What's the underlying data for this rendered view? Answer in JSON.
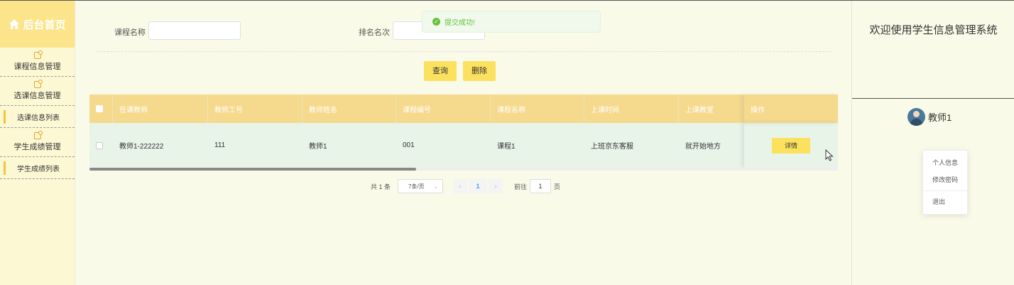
{
  "sidebar": {
    "brand_title": "后台首页",
    "groups": [
      {
        "label": "课程信息管理"
      },
      {
        "label": "选课信息管理",
        "subitems": [
          {
            "label": "选课信息列表"
          }
        ]
      },
      {
        "label": "学生成绩管理",
        "subitems": [
          {
            "label": "学生成绩列表"
          }
        ]
      }
    ]
  },
  "search": {
    "course_name_label": "课程名称",
    "course_name_value": "",
    "rank_label": "排名名次",
    "rank_value": ""
  },
  "toolbar": {
    "query_label": "查询",
    "delete_label": "删除"
  },
  "toast": {
    "message": "提交成功!"
  },
  "table": {
    "columns": [
      "任课教师",
      "教师工号",
      "教师姓名",
      "课程编号",
      "课程名称",
      "上课时间",
      "上课教室",
      "操作"
    ],
    "rows": [
      {
        "cells": [
          "教师1-222222",
          "111",
          "教师1",
          "001",
          "课程1",
          "上班京东客服",
          "就开始地方"
        ],
        "action": "详情"
      }
    ]
  },
  "pagination": {
    "total_text": "共 1 条",
    "page_size": "7条/页",
    "current_page": "1",
    "goto_label": "前往",
    "goto_value": "1",
    "page_unit": "页"
  },
  "header_right": {
    "welcome": "欢迎使用学生信息管理系统",
    "user_name": "教师1",
    "menu": [
      "个人信息",
      "修改密码",
      "退出"
    ]
  },
  "colors": {
    "accent": "#fbe15e",
    "table_header": "#f5d98d",
    "success": "#67c23a"
  }
}
